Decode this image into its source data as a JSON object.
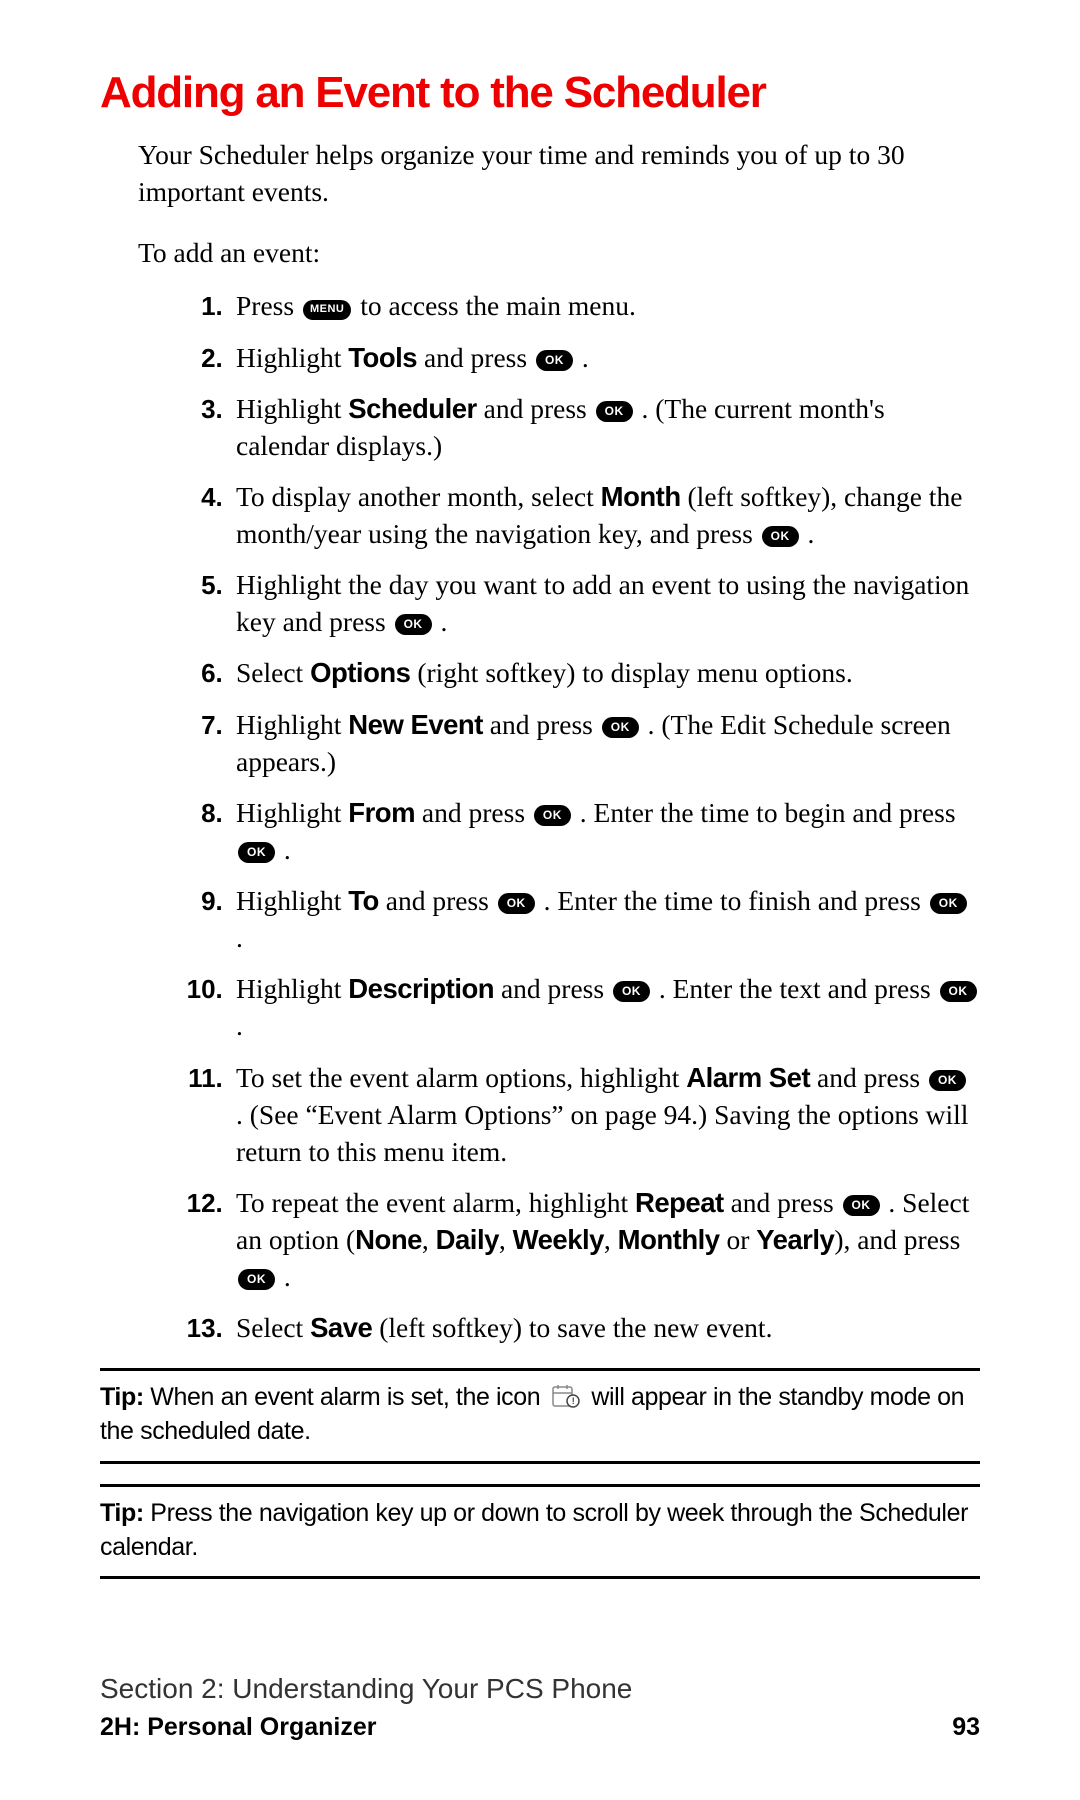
{
  "title": "Adding an Event to the Scheduler",
  "intro": "Your Scheduler helps organize your time and reminds you of up to 30 important events.",
  "leadin": "To add an event:",
  "btn": {
    "menu": "MENU",
    "ok": "OK"
  },
  "steps": {
    "s1a": "Press ",
    "s1b": " to access the main menu.",
    "s2a": "Highlight ",
    "s2_tools": "Tools",
    "s2b": " and press ",
    "s2c": " .",
    "s3a": "Highlight ",
    "s3_sched": "Scheduler",
    "s3b": " and press ",
    "s3c": " . (The current month's calendar displays.)",
    "s4a": "To display another month, select ",
    "s4_month": "Month",
    "s4b": " (left softkey), change the month/year using the navigation key, and press ",
    "s4c": " .",
    "s5a": "Highlight the day you want to add an event to using the navigation key and press ",
    "s5b": " .",
    "s6a": "Select ",
    "s6_opt": "Options",
    "s6b": " (right softkey) to display menu options.",
    "s7a": "Highlight ",
    "s7_ne": "New Event",
    "s7b": " and press ",
    "s7c": " . (The Edit Schedule screen appears.)",
    "s8a": "Highlight ",
    "s8_from": "From",
    "s8b": " and press ",
    "s8c": " . Enter the time to begin and press ",
    "s8d": " .",
    "s9a": "Highlight ",
    "s9_to": "To",
    "s9b": " and press ",
    "s9c": " . Enter the time to finish and press ",
    "s9d": " .",
    "s10a": "Highlight ",
    "s10_desc": "Description",
    "s10b": " and press ",
    "s10c": " . Enter the text and press ",
    "s10d": " .",
    "s11a": "To set the event alarm options, highlight ",
    "s11_as": "Alarm Set",
    "s11b": " and press ",
    "s11c": " . (See “Event Alarm Options” on page 94.) Saving the options will return to this menu item.",
    "s12a": "To repeat the event alarm, highlight ",
    "s12_rep": "Repeat",
    "s12b": " and press ",
    "s12c": " . Select an option (",
    "s12_none": "None",
    "s12_sep1": ", ",
    "s12_daily": "Daily",
    "s12_sep2": ", ",
    "s12_weekly": "Weekly",
    "s12_sep3": ", ",
    "s12_monthly": "Monthly",
    "s12_sep4": " or ",
    "s12_yearly": "Yearly",
    "s12d": "), and press ",
    "s12e": " .",
    "s13a": "Select ",
    "s13_save": "Save",
    "s13b": " (left softkey) to save the new event."
  },
  "tip1": {
    "label": "Tip:",
    "a": " When an event alarm is set, the icon ",
    "b": " will appear in the standby mode on the scheduled date."
  },
  "tip2": {
    "label": "Tip:",
    "text": " Press the navigation key up or down to scroll by week through the Scheduler calendar."
  },
  "footer": {
    "section": "Section 2: Understanding Your PCS Phone",
    "chapter": "2H: Personal Organizer",
    "page": "93"
  }
}
